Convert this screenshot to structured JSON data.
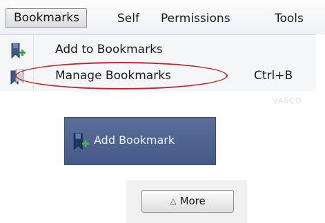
{
  "menubar": {
    "items": [
      {
        "label": "Bookmarks"
      },
      {
        "label": "Self"
      },
      {
        "label": "Permissions"
      },
      {
        "label": "Tools"
      }
    ]
  },
  "dropdown": {
    "items": [
      {
        "label": "Add to Bookmarks",
        "shortcut": "",
        "icon": "bookmark-add-icon"
      },
      {
        "label": "Manage Bookmarks",
        "shortcut": "Ctrl+B",
        "icon": "bookmark-manage-icon"
      }
    ],
    "highlight_color": "#c0272d"
  },
  "watermark": {
    "text": "VASCO"
  },
  "toolbar_button": {
    "label": "Add Bookmark",
    "icon": "bookmark-add-icon",
    "color": "#4d6190"
  },
  "more_button": {
    "arrow": "△",
    "label": "More"
  }
}
